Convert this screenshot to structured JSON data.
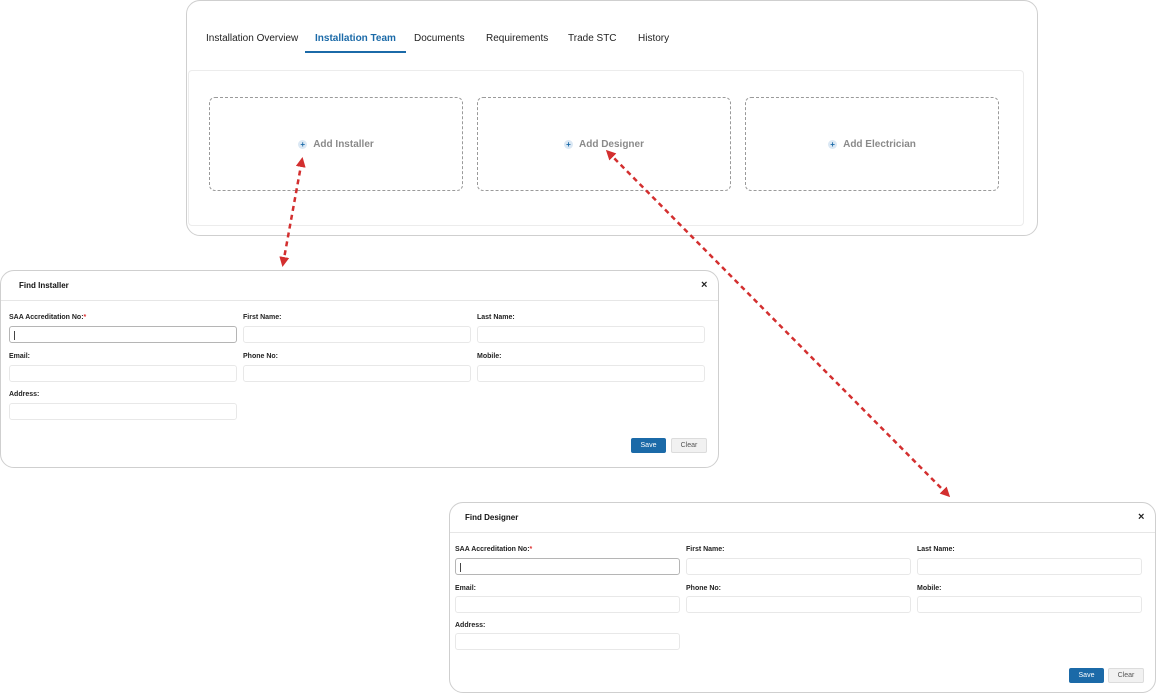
{
  "tabs": [
    {
      "label": "Installation Overview"
    },
    {
      "label": "Installation Team"
    },
    {
      "label": "Documents"
    },
    {
      "label": "Requirements"
    },
    {
      "label": "Trade STC"
    },
    {
      "label": "History"
    }
  ],
  "active_tab": "Installation Team",
  "team_cards": [
    {
      "icon": "plus-circle-icon",
      "label": "Add Installer"
    },
    {
      "icon": "plus-circle-icon",
      "label": "Add Designer"
    },
    {
      "icon": "plus-circle-icon",
      "label": "Add Electrician"
    }
  ],
  "installer_modal": {
    "title": "Find Installer",
    "close": "×",
    "fields": {
      "saa": {
        "label": "SAA Accreditation No:",
        "required": "*",
        "value": ""
      },
      "first_name": {
        "label": "First Name:",
        "value": ""
      },
      "last_name": {
        "label": "Last Name:",
        "value": ""
      },
      "email": {
        "label": "Email:",
        "value": ""
      },
      "phone": {
        "label": "Phone No:",
        "value": ""
      },
      "mobile": {
        "label": "Mobile:",
        "value": ""
      },
      "address": {
        "label": "Address:",
        "value": ""
      }
    },
    "save_label": "Save",
    "clear_label": "Clear"
  },
  "designer_modal": {
    "title": "Find Designer",
    "close": "×",
    "fields": {
      "saa": {
        "label": "SAA Accreditation No:",
        "required": "*",
        "value": ""
      },
      "first_name": {
        "label": "First Name:",
        "value": ""
      },
      "last_name": {
        "label": "Last Name:",
        "value": ""
      },
      "email": {
        "label": "Email:",
        "value": ""
      },
      "phone": {
        "label": "Phone No:",
        "value": ""
      },
      "mobile": {
        "label": "Mobile:",
        "value": ""
      },
      "address": {
        "label": "Address:",
        "value": ""
      }
    },
    "save_label": "Save",
    "clear_label": "Clear"
  },
  "colors": {
    "accent": "#1b6aa8",
    "annotation_arrow": "#d32f2f",
    "required": "#dd3333"
  }
}
